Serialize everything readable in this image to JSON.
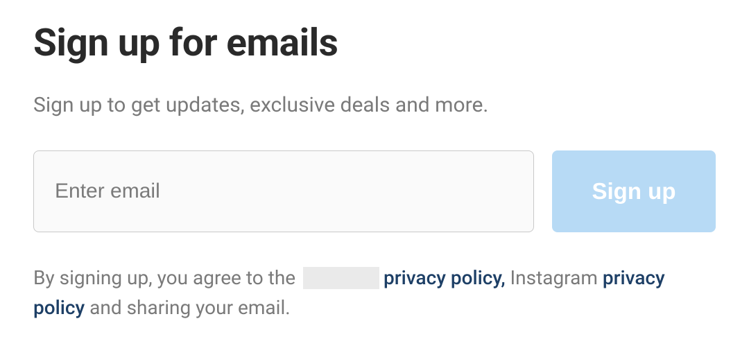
{
  "heading": "Sign up for emails",
  "subheading": "Sign up to get updates, exclusive deals and more.",
  "form": {
    "email_placeholder": "Enter email",
    "submit_label": "Sign up"
  },
  "legal": {
    "prefix": "By signing up, you agree to the ",
    "link1": "privacy policy,",
    "mid": " Instagram ",
    "link2": "privacy policy",
    "suffix": " and sharing your email."
  }
}
